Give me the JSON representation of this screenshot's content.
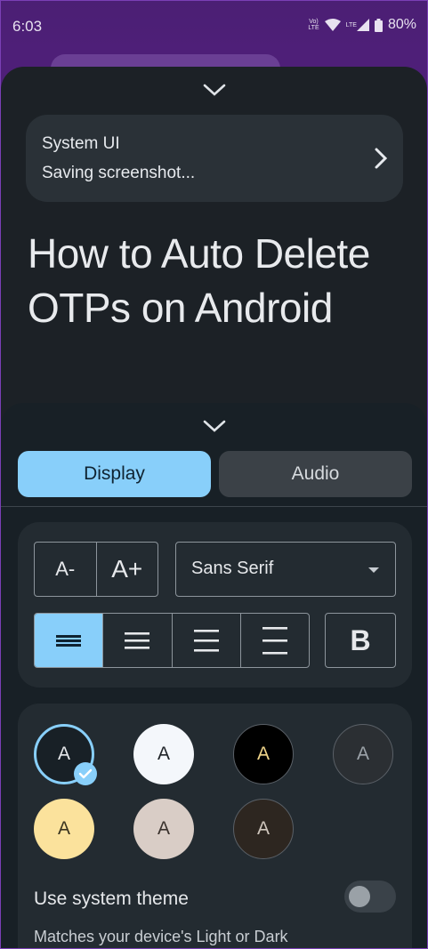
{
  "status_bar": {
    "time": "6:03",
    "network_tag_top": "Vo)",
    "network_tag_bottom": "LTE",
    "lte": "LTE",
    "battery": "80%"
  },
  "notification": {
    "app": "System UI",
    "text": "Saving screenshot..."
  },
  "article": {
    "title": "How to Auto Delete OTPs on Android"
  },
  "reading_mode": {
    "tabs": [
      {
        "label": "Display",
        "selected": true
      },
      {
        "label": "Audio",
        "selected": false
      }
    ],
    "font_size": {
      "decrease_label": "A-",
      "increase_label": "A+"
    },
    "font_family": {
      "value": "Sans Serif"
    },
    "bold_label": "B",
    "color_swatch_letter": "A",
    "themes": [
      {
        "bg": "#182026",
        "fg": "#e6e8eb",
        "selected": true
      },
      {
        "bg": "#f4f7fb",
        "fg": "#1f2328",
        "selected": false
      },
      {
        "bg": "#000000",
        "fg": "#f0d58a",
        "selected": false
      },
      {
        "bg": "#2b2f33",
        "fg": "#9ca3a9",
        "selected": false
      },
      {
        "bg": "#fbe29c",
        "fg": "#3a3420",
        "selected": false
      },
      {
        "bg": "#d9cdc6",
        "fg": "#3a322d",
        "selected": false
      },
      {
        "bg": "#2d2620",
        "fg": "#cfc6bd",
        "selected": false
      }
    ],
    "use_system_theme": {
      "label": "Use system theme",
      "on": false
    },
    "system_theme_description": "Matches your device's Light or Dark"
  },
  "colors": {
    "accent": "#88cffa"
  }
}
